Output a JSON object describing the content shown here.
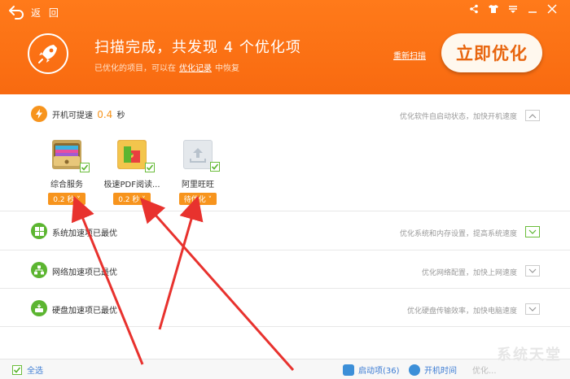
{
  "header": {
    "back_label": "返 回",
    "title": "扫描完成，共发现  4  个优化项",
    "sub_prefix": "已优化的项目，可以在",
    "sub_link": "优化记录",
    "sub_suffix": "中恢复",
    "rescan": "重新扫描",
    "optimize_button": "立即优化",
    "window_controls": [
      "share-icon",
      "shirt-icon",
      "menu-icon",
      "minimize-icon",
      "close-icon"
    ]
  },
  "startup": {
    "title_prefix": "开机可提速",
    "value": "0.4",
    "unit": "秒",
    "desc": "优化软件自启动状态，加快开机速度",
    "apps": [
      {
        "name": "综合服务",
        "badge": "0.2 秒",
        "icon": "wallet-icon"
      },
      {
        "name": "极速PDF阅读...",
        "badge": "0.2 秒",
        "icon": "puzzle-icon"
      },
      {
        "name": "阿里旺旺",
        "badge": "待优化",
        "icon": "upload-icon"
      }
    ]
  },
  "sections": [
    {
      "title": "系统加速项已最优",
      "desc": "优化系统和内存设置，提高系统速度",
      "icon": "windows-icon"
    },
    {
      "title": "网络加速项已最优",
      "desc": "优化网络配置，加快上网速度",
      "icon": "network-icon"
    },
    {
      "title": "硬盘加速项已最优",
      "desc": "优化硬盘传输效率，加快电脑速度",
      "icon": "disk-icon"
    }
  ],
  "footer": {
    "select_all": "全选",
    "startup_items": "启动项(36)",
    "boot_time": "开机时间",
    "truncated": "优化..."
  },
  "watermark": "系统天堂",
  "colors": {
    "accent": "#f86a10",
    "green": "#5cb531",
    "orange": "#f7941d",
    "arrow": "#e8322e"
  }
}
